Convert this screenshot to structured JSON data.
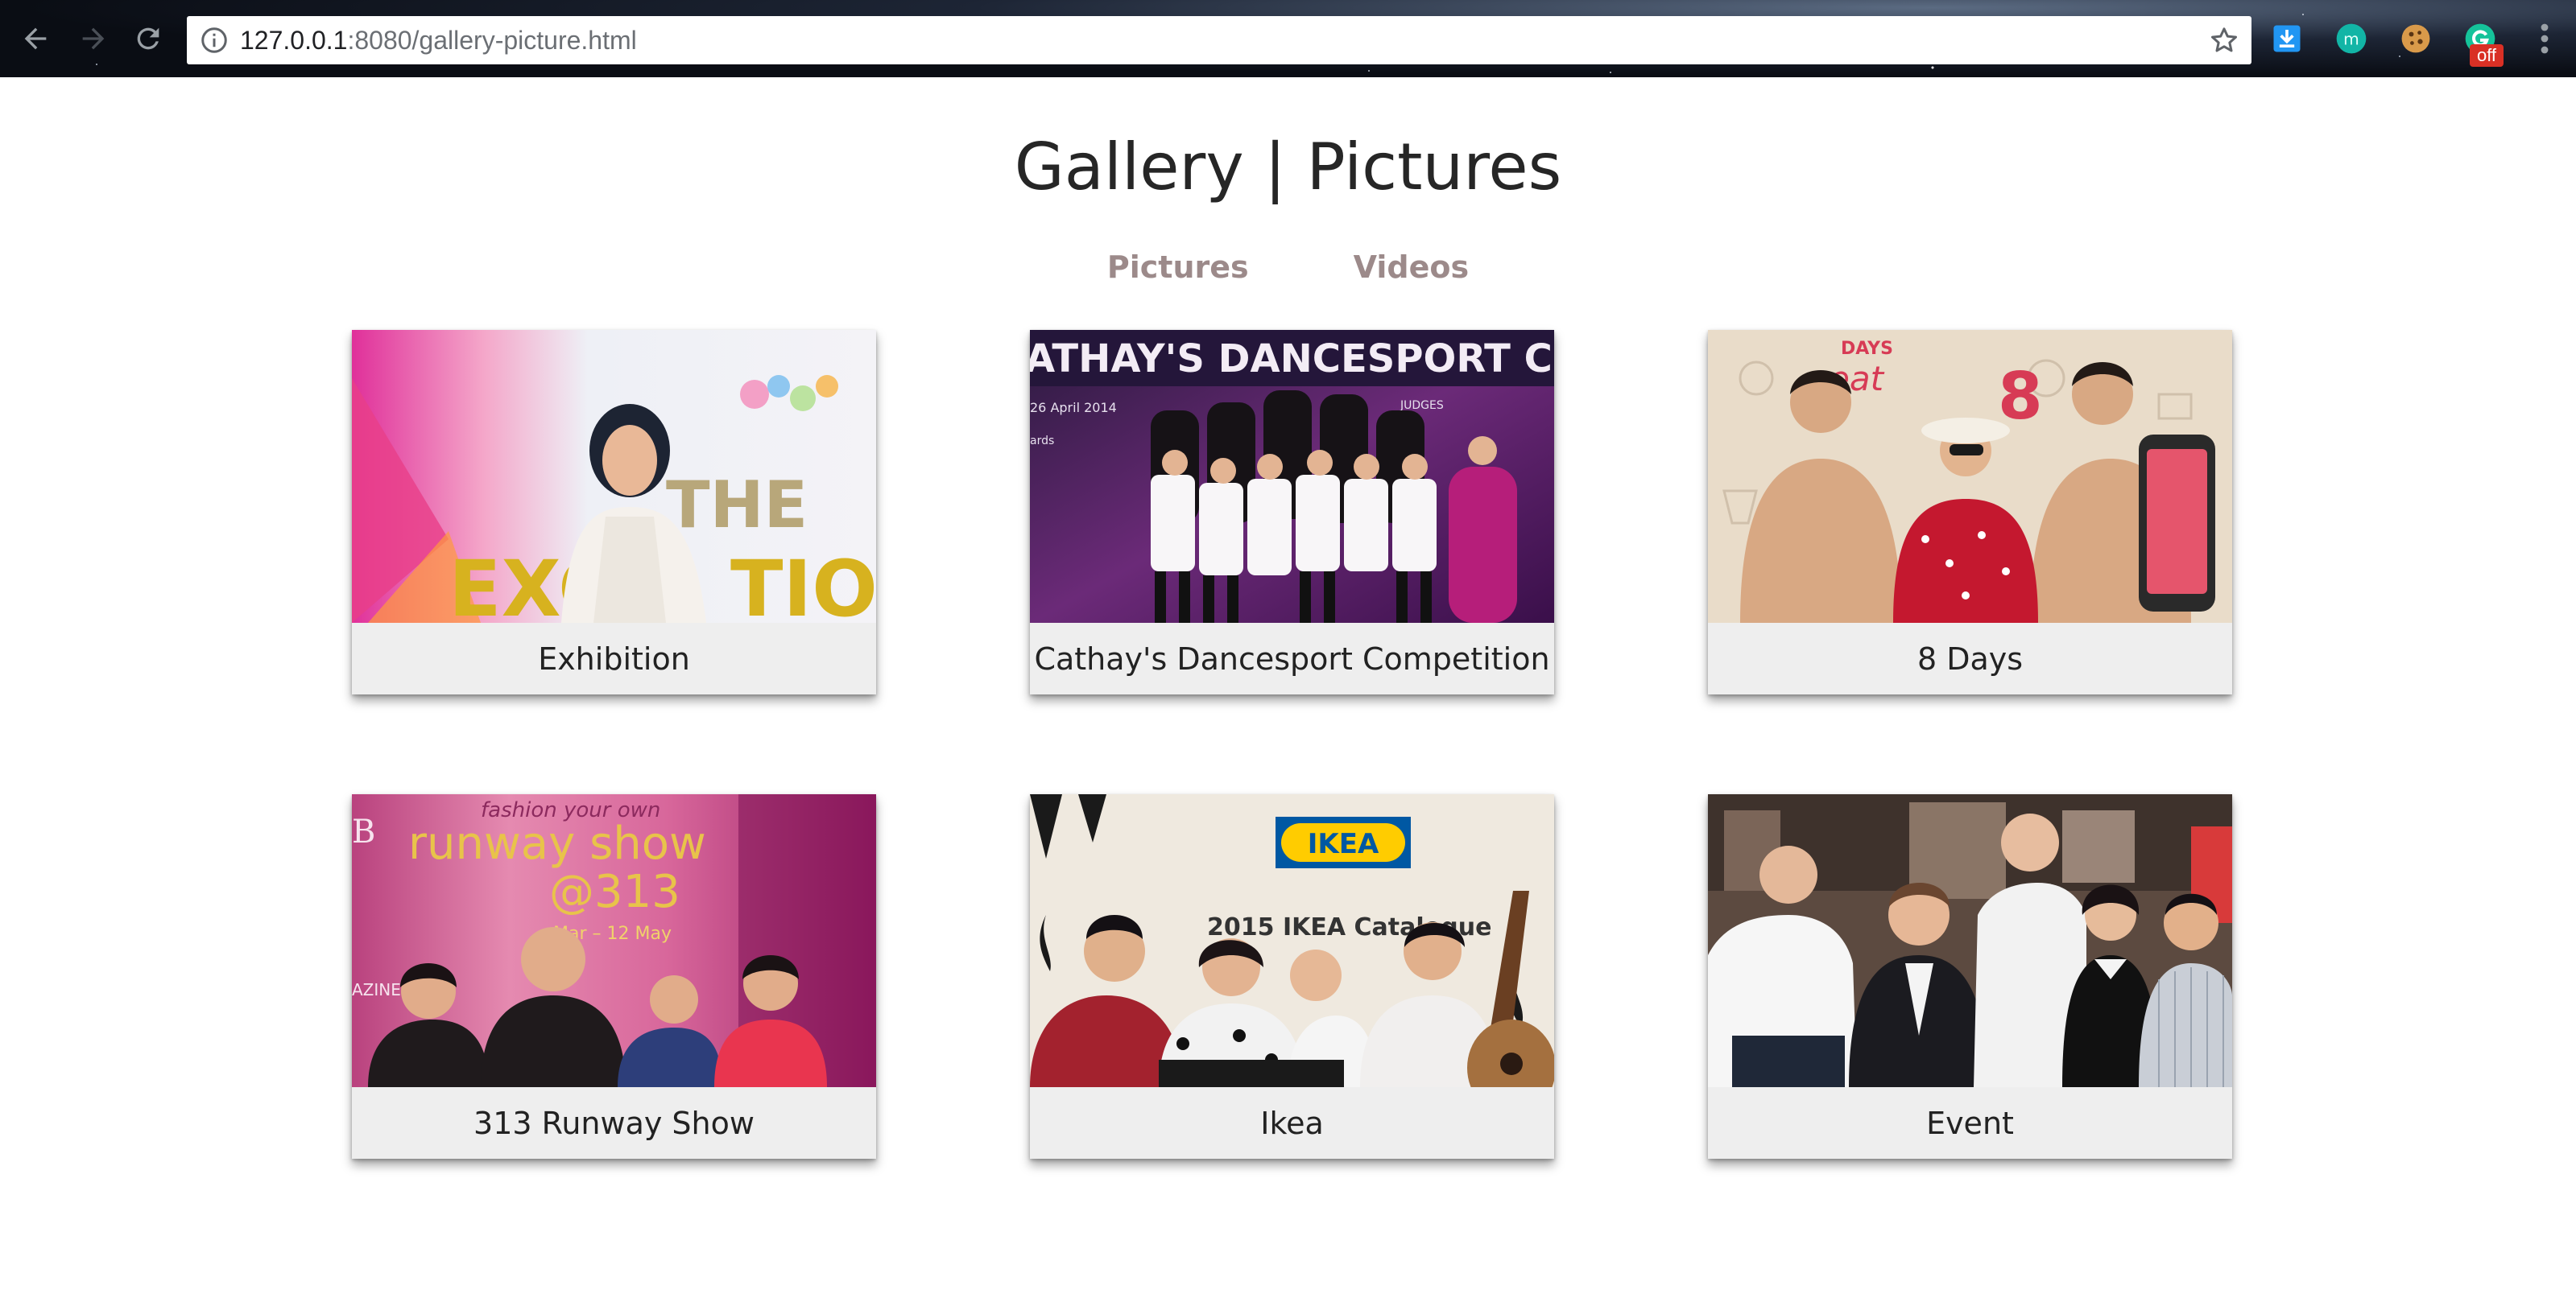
{
  "browser": {
    "url_host": "127.0.0.1",
    "url_rest": ":8080/gallery-picture.html",
    "extensions": [
      "download-icon",
      "m-icon",
      "cookie-icon",
      "grammar-icon"
    ],
    "ext_badge": "off"
  },
  "page": {
    "title": "Gallery | Pictures",
    "tabs": [
      {
        "label": "Pictures"
      },
      {
        "label": "Videos"
      }
    ]
  },
  "gallery": {
    "items": [
      {
        "caption": "Exhibition",
        "photo_text": [
          "THE",
          "EXC",
          "TION"
        ]
      },
      {
        "caption": "Cathay's Dancesport Competition",
        "photo_text": [
          "ATHAY'S DANCESPORT COMPETITIO",
          "26 April 2014",
          "JUDGES",
          "ards"
        ]
      },
      {
        "caption": "8 Days",
        "photo_text": [
          "8",
          "DAYS",
          "eat"
        ]
      },
      {
        "caption": "313 Runway Show",
        "photo_text": [
          "fashion your own",
          "runway show",
          "@313",
          "Mar – 12 May",
          "AZINE",
          "B"
        ]
      },
      {
        "caption": "Ikea",
        "photo_text": [
          "IKEA",
          "2015 IKEA Catalogue"
        ]
      },
      {
        "caption": "Event",
        "photo_text": []
      }
    ]
  },
  "colors": {
    "title": "#262626",
    "tab_link": "#9c8a8a",
    "caption_bg": "#eeeeee"
  }
}
